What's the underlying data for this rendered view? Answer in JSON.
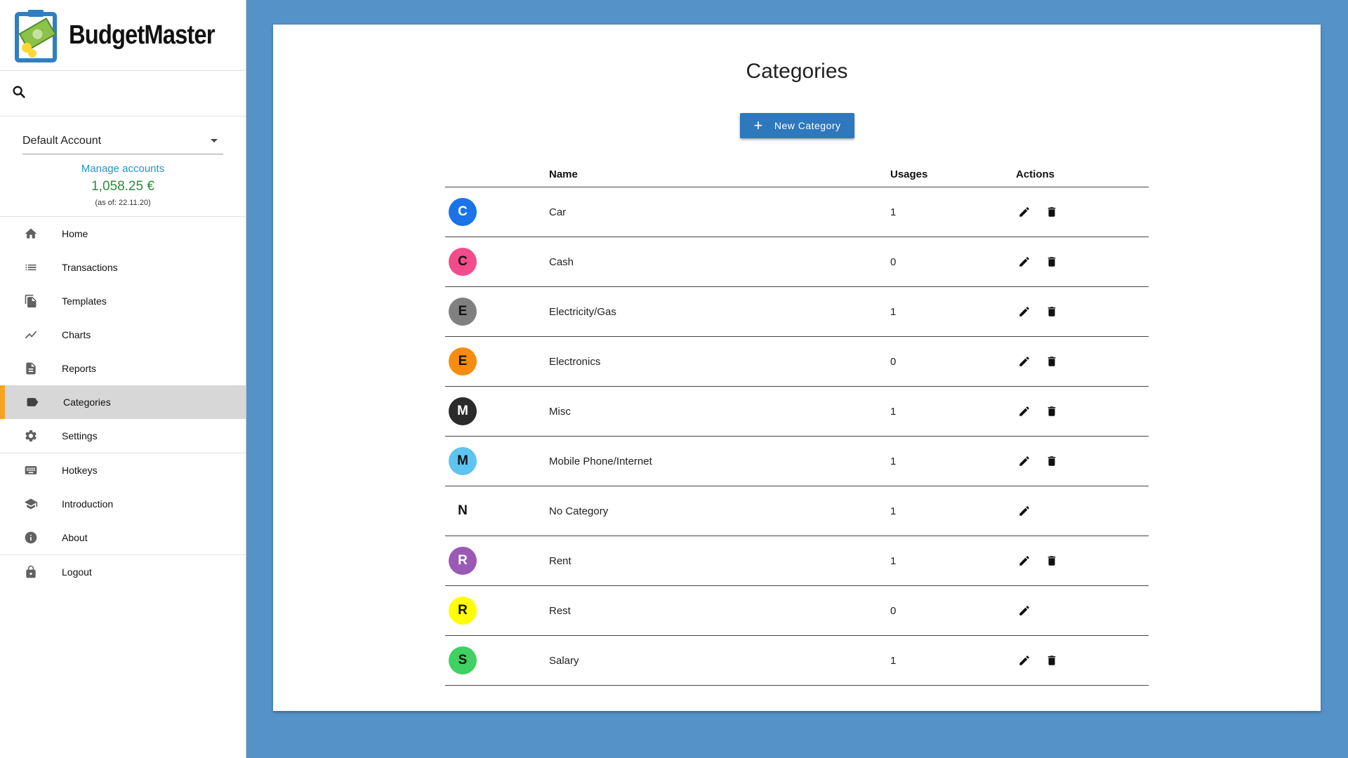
{
  "app": {
    "name": "BudgetMaster"
  },
  "account": {
    "selected": "Default Account",
    "manage_label": "Manage accounts",
    "balance": "1,058.25 €",
    "as_of": "(as of: 22.11.20)"
  },
  "nav": {
    "home": "Home",
    "transactions": "Transactions",
    "templates": "Templates",
    "charts": "Charts",
    "reports": "Reports",
    "categories": "Categories",
    "settings": "Settings",
    "hotkeys": "Hotkeys",
    "introduction": "Introduction",
    "about": "About",
    "logout": "Logout"
  },
  "page": {
    "title": "Categories",
    "new_button": "New Category"
  },
  "table": {
    "headers": {
      "name": "Name",
      "usages": "Usages",
      "actions": "Actions"
    },
    "rows": [
      {
        "letter": "C",
        "name": "Car",
        "usages": "1",
        "color": "#1a73e8",
        "text_color": "#ffffff",
        "deletable": true
      },
      {
        "letter": "C",
        "name": "Cash",
        "usages": "0",
        "color": "#f24c8c",
        "text_color": "#111111",
        "deletable": true
      },
      {
        "letter": "E",
        "name": "Electricity/Gas",
        "usages": "1",
        "color": "#808080",
        "text_color": "#111111",
        "deletable": true
      },
      {
        "letter": "E",
        "name": "Electronics",
        "usages": "0",
        "color": "#f78c0f",
        "text_color": "#111111",
        "deletable": true
      },
      {
        "letter": "M",
        "name": "Misc",
        "usages": "1",
        "color": "#2b2b2b",
        "text_color": "#ffffff",
        "deletable": true
      },
      {
        "letter": "M",
        "name": "Mobile Phone/Internet",
        "usages": "1",
        "color": "#5ec3f0",
        "text_color": "#111111",
        "deletable": true
      },
      {
        "letter": "N",
        "name": "No Category",
        "usages": "1",
        "color": "#ffffff",
        "text_color": "#111111",
        "deletable": false
      },
      {
        "letter": "R",
        "name": "Rent",
        "usages": "1",
        "color": "#9b59b6",
        "text_color": "#ffffff",
        "deletable": true
      },
      {
        "letter": "R",
        "name": "Rest",
        "usages": "0",
        "color": "#ffff00",
        "text_color": "#111111",
        "deletable": false
      },
      {
        "letter": "S",
        "name": "Salary",
        "usages": "1",
        "color": "#3fd163",
        "text_color": "#111111",
        "deletable": true
      }
    ]
  },
  "icons": {
    "search": "search-icon",
    "edit": "pencil-icon",
    "delete": "trash-icon"
  }
}
